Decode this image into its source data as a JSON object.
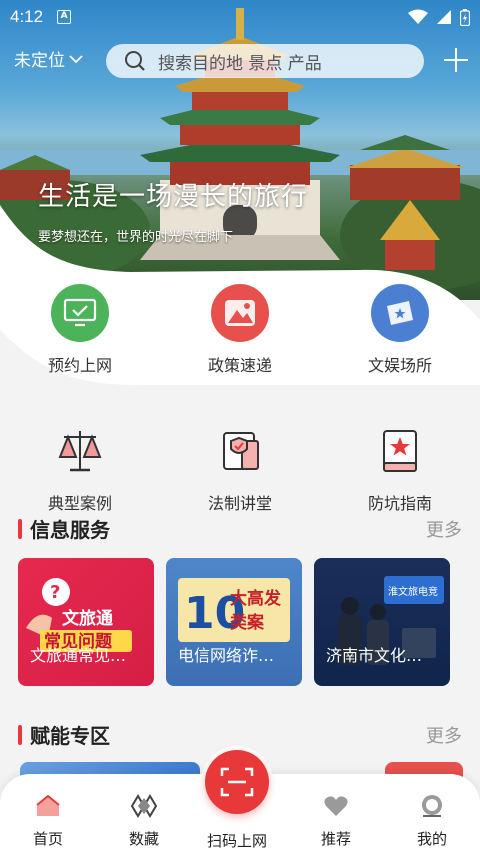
{
  "status_bar": {
    "time": "4:12"
  },
  "header": {
    "location": "未定位",
    "search_placeholder": "搜索目的地 景点 产品"
  },
  "hero": {
    "slogan": "生活是一场漫长的旅行",
    "subslogan": "要梦想还在，世界的时光尽在脚下"
  },
  "services_row1": [
    {
      "label": "预约上网",
      "icon": "monitor-icon",
      "color": "#4cb35a"
    },
    {
      "label": "政策速递",
      "icon": "image-icon",
      "color": "#e8504d"
    },
    {
      "label": "文娱场所",
      "icon": "ticket-icon",
      "color": "#4a7fd1"
    }
  ],
  "services_row2": [
    {
      "label": "典型案例",
      "icon": "scales-icon"
    },
    {
      "label": "法制讲堂",
      "icon": "shield-book-icon"
    },
    {
      "label": "防坑指南",
      "icon": "star-book-icon"
    }
  ],
  "info_section": {
    "title": "信息服务",
    "more": "更多",
    "cards": [
      {
        "title": "文旅通常见…",
        "poster_lines": [
          "文旅通",
          "常见问题"
        ],
        "poster_badge": "?"
      },
      {
        "title": "电信网络诈…",
        "poster_lines": [
          "10",
          "大高发",
          "类案"
        ]
      },
      {
        "title": "济南市文化…",
        "poster_lines": [
          "淮文旅电竞"
        ]
      }
    ]
  },
  "empower_section": {
    "title": "赋能专区",
    "more": "更多"
  },
  "bottom_nav": [
    {
      "label": "首页",
      "icon": "home-icon"
    },
    {
      "label": "数藏",
      "icon": "collection-icon"
    },
    {
      "label": "扫码上网",
      "icon": "scan-icon"
    },
    {
      "label": "推荐",
      "icon": "heart-icon"
    },
    {
      "label": "我的",
      "icon": "profile-icon"
    }
  ],
  "colors": {
    "accent": "#e8393a",
    "green": "#4cb35a",
    "red": "#e8504d",
    "blue": "#4a7fd1"
  }
}
